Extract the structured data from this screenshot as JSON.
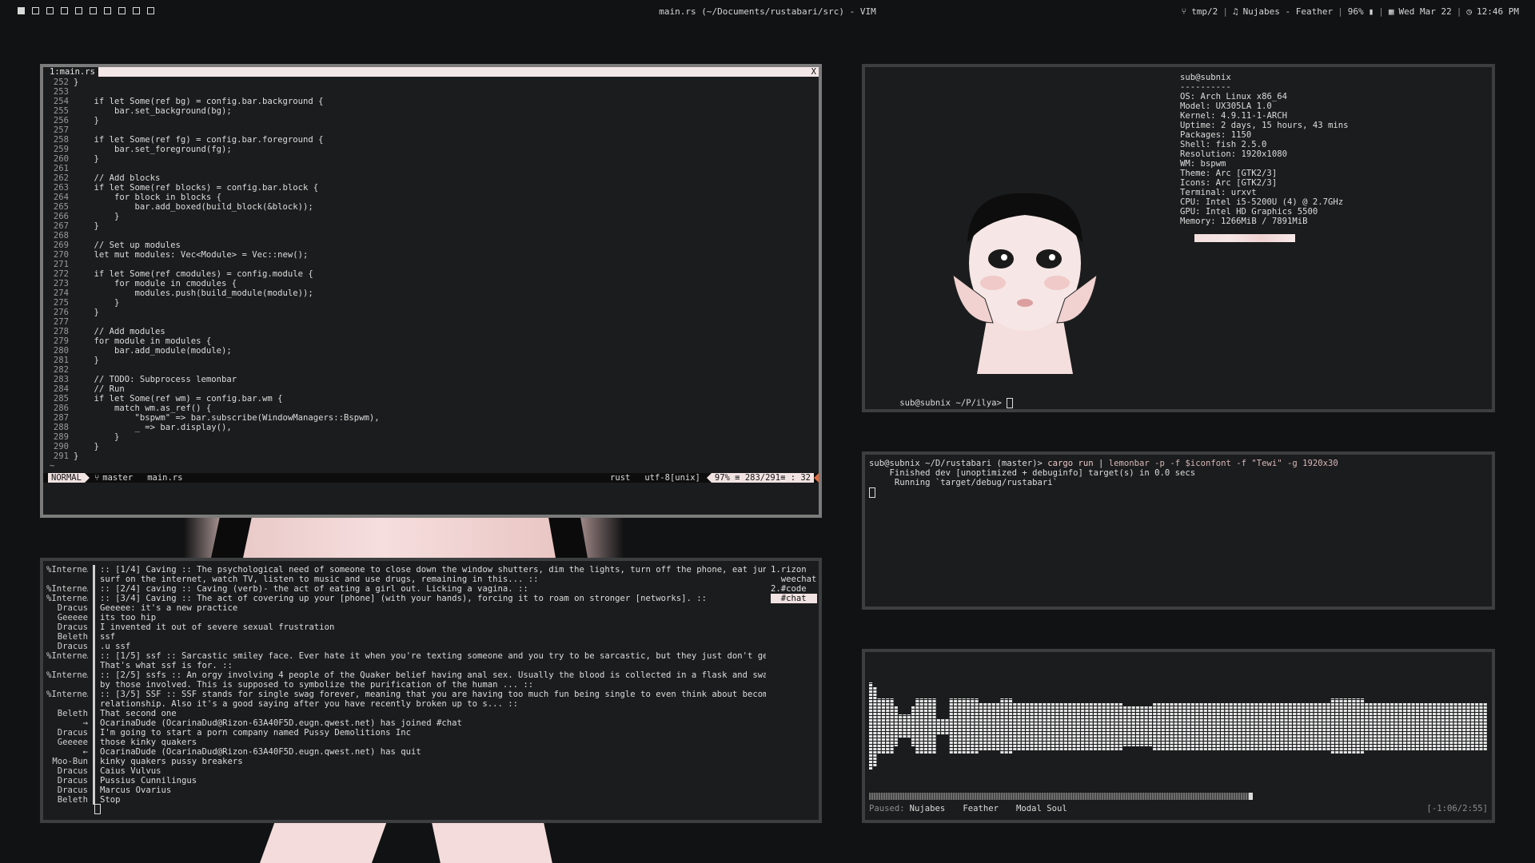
{
  "topbar": {
    "workspace_count": 10,
    "active_workspace": 1,
    "window_title": "main.rs (~/Documents/rustabari/src) - VIM",
    "branch_icon": "git-branch-icon",
    "tmp": "tmp/2",
    "music_icon": "music-note-icon",
    "now_playing": "Nujabes - Feather",
    "battery": "96%",
    "date": "Wed Mar 22",
    "time": "12:46 PM"
  },
  "vim": {
    "tab_label": "1:main.rs",
    "close": "X",
    "lines": [
      [
        "252",
        "}"
      ],
      [
        "253",
        ""
      ],
      [
        "254",
        "    if let Some(ref bg) = config.bar.background {"
      ],
      [
        "255",
        "        bar.set_background(bg);"
      ],
      [
        "256",
        "    }"
      ],
      [
        "257",
        ""
      ],
      [
        "258",
        "    if let Some(ref fg) = config.bar.foreground {"
      ],
      [
        "259",
        "        bar.set_foreground(fg);"
      ],
      [
        "260",
        "    }"
      ],
      [
        "261",
        ""
      ],
      [
        "262",
        "    // Add blocks"
      ],
      [
        "263",
        "    if let Some(ref blocks) = config.bar.block {"
      ],
      [
        "264",
        "        for block in blocks {"
      ],
      [
        "265",
        "            bar.add_boxed(build_block(&block));"
      ],
      [
        "266",
        "        }"
      ],
      [
        "267",
        "    }"
      ],
      [
        "268",
        ""
      ],
      [
        "269",
        "    // Set up modules"
      ],
      [
        "270",
        "    let mut modules: Vec<Module> = Vec::new();"
      ],
      [
        "271",
        ""
      ],
      [
        "272",
        "    if let Some(ref cmodules) = config.module {"
      ],
      [
        "273",
        "        for module in cmodules {"
      ],
      [
        "274",
        "            modules.push(build_module(module));"
      ],
      [
        "275",
        "        }"
      ],
      [
        "276",
        "    }"
      ],
      [
        "277",
        ""
      ],
      [
        "278",
        "    // Add modules"
      ],
      [
        "279",
        "    for module in modules {"
      ],
      [
        "280",
        "        bar.add_module(module);"
      ],
      [
        "281",
        "    }"
      ],
      [
        "282",
        ""
      ],
      [
        "283",
        "    // TODO: Subprocess lemonbar"
      ],
      [
        "284",
        "    // Run"
      ],
      [
        "285",
        "    if let Some(ref wm) = config.bar.wm {"
      ],
      [
        "286",
        "        match wm.as_ref() {"
      ],
      [
        "287",
        "            \"bspwm\" => bar.subscribe(WindowManagers::Bspwm),"
      ],
      [
        "288",
        "            _ => bar.display(),"
      ],
      [
        "289",
        "        }"
      ],
      [
        "290",
        "    }"
      ],
      [
        "291",
        "}"
      ]
    ],
    "tilde": "~",
    "status": {
      "mode": "NORMAL",
      "branch": "master",
      "file": "main.rs",
      "filetype": "rust",
      "encoding": "utf-8[unix]",
      "position": "97% ≡ 283/291≡ : 32"
    }
  },
  "neofetch": {
    "header": "sub@subnix",
    "underline": "----------",
    "rows": [
      {
        "key": "OS",
        "value": "Arch Linux x86_64"
      },
      {
        "key": "Model",
        "value": "UX305LA 1.0"
      },
      {
        "key": "Kernel",
        "value": "4.9.11-1-ARCH"
      },
      {
        "key": "Uptime",
        "value": "2 days, 15 hours, 43 mins"
      },
      {
        "key": "Packages",
        "value": "1150"
      },
      {
        "key": "Shell",
        "value": "fish 2.5.0"
      },
      {
        "key": "Resolution",
        "value": "1920x1080"
      },
      {
        "key": "WM",
        "value": "bspwm"
      },
      {
        "key": "Theme",
        "value": "Arc [GTK2/3]"
      },
      {
        "key": "Icons",
        "value": "Arc [GTK2/3]"
      },
      {
        "key": "Terminal",
        "value": "urxvt"
      },
      {
        "key": "CPU",
        "value": "Intel i5-5200U (4) @ 2.7GHz"
      },
      {
        "key": "GPU",
        "value": "Intel HD Graphics 5500"
      },
      {
        "key": "Memory",
        "value": "1266MiB / 7891MiB"
      }
    ],
    "prompt": "sub@subnix ~/P/ilya> "
  },
  "cargo": {
    "prompt": "sub@subnix ~/D/rustabari (master)> ",
    "cmd1": "cargo run",
    "pipe": " | ",
    "cmd2": "lemonbar -p -f $iconfont -f \"Tewi\" -g 1920x30",
    "line2": "    Finished dev [unoptimized + debuginfo] target(s) in 0.0 secs",
    "line3": "     Running `target/debug/rustabari`"
  },
  "weechat": {
    "rows": [
      {
        "nick": "%Interne…",
        "msg": ":: [1/4] Caving :: The psychological need of someone to close down the window shutters, dim the lights, turn off the phone, eat junk food,"
      },
      {
        "nick": "",
        "msg": "surf on the internet, watch TV, listen to music and use drugs, remaining in this... ::"
      },
      {
        "nick": "%Interne…",
        "msg": ":: [2/4] caving :: Caving (verb)- the act of eating a girl out. Licking a vagina. ::"
      },
      {
        "nick": "%Interne…",
        "msg": ":: [3/4] Caving :: The act of covering up your [phone] (with your hands), forcing it to roam on stronger [networks]. ::"
      },
      {
        "nick": "Dracus",
        "msg": "Geeeee: it's a new practice"
      },
      {
        "nick": "Geeeee",
        "msg": "its too hip"
      },
      {
        "nick": "Dracus",
        "msg": "I invented it out of severe sexual frustration"
      },
      {
        "nick": "Beleth",
        "msg": "ssf"
      },
      {
        "nick": "Dracus",
        "msg": ".u ssf"
      },
      {
        "nick": "%Interne…",
        "msg": ":: [1/5] ssf :: Sarcastic smiley face. Ever hate it when you're texting someone and you try to be sarcastic, but they just don't get it?"
      },
      {
        "nick": "",
        "msg": "That's what ssf is for. ::"
      },
      {
        "nick": "%Interne…",
        "msg": ":: [2/5] ssfs :: An orgy involving 4 people of the Quaker belief having anal sex. Usually the blood is collected in a flask and swallowed"
      },
      {
        "nick": "",
        "msg": "by those involved. This is supposed to symbolize the purification of the human ... ::"
      },
      {
        "nick": "%Interne…",
        "msg": ":: [3/5] SSF :: SSF stands for single swag forever, meaning that you are having too much fun being single to even think about becoming in a"
      },
      {
        "nick": "",
        "msg": "relationship. Also it's a good saying after you have recently broken up to s... ::"
      },
      {
        "nick": "Beleth",
        "msg": "That second one"
      },
      {
        "nick": "→",
        "msg": "OcarinaDude (OcarinaDud@Rizon-63A40F5D.eugn.qwest.net) has joined #chat"
      },
      {
        "nick": "Dracus",
        "msg": "I'm going to start a porn company named Pussy Demolitions Inc"
      },
      {
        "nick": "Geeeee",
        "msg": "those kinky quakers"
      },
      {
        "nick": "←",
        "msg": "OcarinaDude (OcarinaDud@Rizon-63A40F5D.eugn.qwest.net) has quit"
      },
      {
        "nick": "Moo-Bun",
        "msg": "kinky quakers pussy breakers"
      },
      {
        "nick": "Dracus",
        "msg": "Caius Vulvus"
      },
      {
        "nick": "Dracus",
        "msg": "Pussius Cunnilingus"
      },
      {
        "nick": "Dracus",
        "msg": "Marcus Ovarius"
      },
      {
        "nick": "Beleth",
        "msg": "Stop"
      }
    ],
    "buffers": [
      "1.rizon",
      "  weechat",
      "2.#code",
      "  #chat"
    ],
    "active_buffer": 3
  },
  "music": {
    "paused_label": "Paused:",
    "artist": "Nujabes",
    "title": "Feather",
    "album": "Modal Soul",
    "time": "[-1:06/2:55]",
    "progress": 0.62,
    "bars": [
      11,
      10,
      7,
      7,
      7,
      7,
      5,
      3,
      3,
      3,
      5,
      7,
      7,
      7,
      7,
      7,
      2,
      2,
      2,
      7,
      7,
      7,
      7,
      7,
      7,
      7,
      6,
      6,
      6,
      6,
      6,
      7,
      7,
      7,
      6,
      6,
      6,
      6,
      6,
      6,
      6,
      6,
      6,
      6,
      6,
      6,
      6,
      6,
      6,
      6,
      6,
      6,
      6,
      6,
      6,
      6,
      6,
      6,
      6,
      6,
      5,
      5,
      5,
      5,
      5,
      5,
      5,
      6,
      6,
      6,
      6,
      6,
      6,
      6,
      6,
      6,
      6,
      6,
      6,
      6,
      6,
      6,
      6,
      6,
      6,
      6,
      6,
      6,
      6,
      6,
      6,
      6,
      6,
      6,
      6,
      6,
      6,
      6,
      6,
      6,
      6,
      6,
      6,
      6,
      6,
      6,
      6,
      6,
      6,
      7,
      7,
      7,
      7,
      7,
      7,
      7,
      7,
      6,
      6,
      6,
      6,
      6,
      6,
      6,
      6,
      6,
      6,
      6,
      6,
      6,
      6,
      6,
      6,
      6,
      6,
      6,
      6,
      6,
      6,
      6,
      6,
      6,
      6,
      6,
      6,
      6
    ]
  }
}
